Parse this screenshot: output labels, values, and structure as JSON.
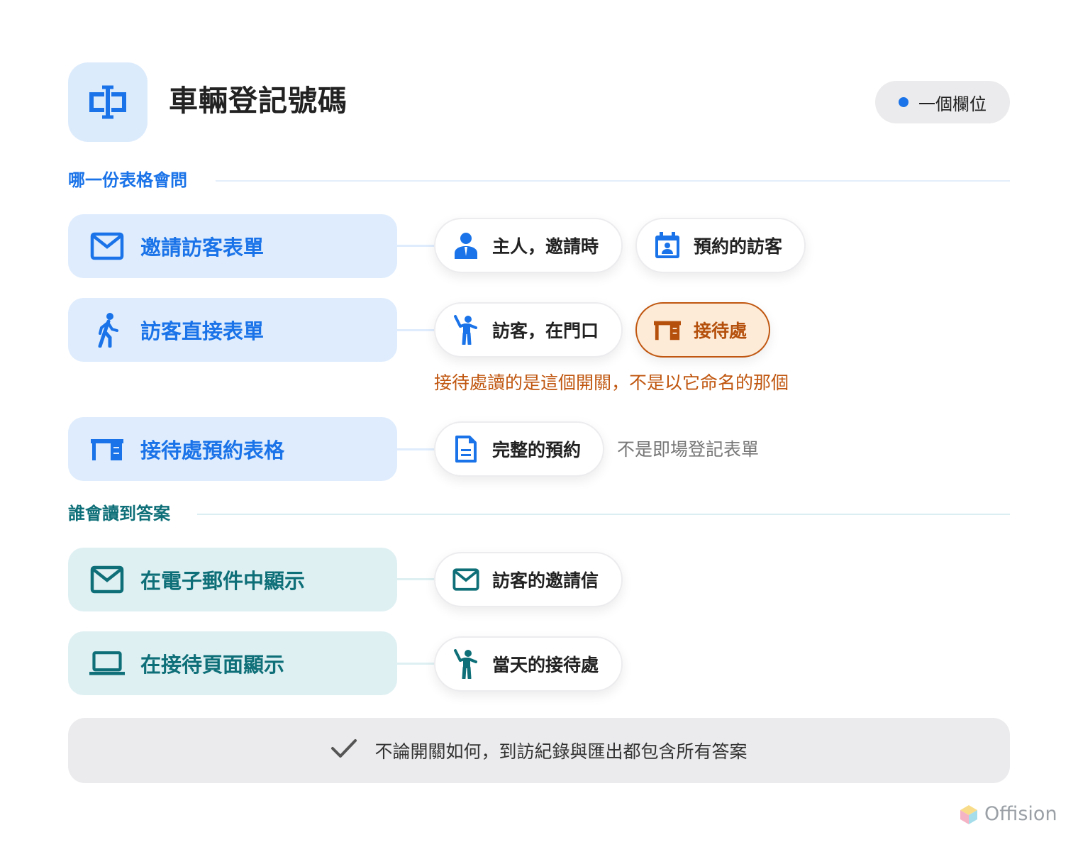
{
  "header": {
    "title": "車輛登記號碼",
    "badge": "一個欄位",
    "icon": "text-field-icon",
    "accent": "#1a73e8"
  },
  "sections": {
    "forms_heading": "哪一份表格會問",
    "readers_heading": "誰會讀到答案"
  },
  "forms": [
    {
      "label": "邀請訪客表單",
      "icon": "mail-icon",
      "chips": [
        {
          "label": "主人，邀請時",
          "icon": "host-person-icon"
        },
        {
          "label": "預約的訪客",
          "icon": "calendar-person-icon"
        }
      ]
    },
    {
      "label": "訪客直接表單",
      "icon": "walking-person-icon",
      "chips": [
        {
          "label": "訪客，在門口",
          "icon": "waving-person-icon"
        },
        {
          "label": "接待處",
          "icon": "reception-desk-icon",
          "highlight": true
        }
      ],
      "note": "接待處讀的是這個開關，不是以它命名的那個"
    },
    {
      "label": "接待處預約表格",
      "icon": "reception-desk-icon",
      "chips": [
        {
          "label": "完整的預約",
          "icon": "document-icon"
        }
      ],
      "note": "不是即場登記表單"
    }
  ],
  "readers": [
    {
      "label": "在電子郵件中顯示",
      "icon": "mail-icon",
      "chips": [
        {
          "label": "訪客的邀請信",
          "icon": "mail-icon"
        }
      ]
    },
    {
      "label": "在接待頁面顯示",
      "icon": "laptop-icon",
      "chips": [
        {
          "label": "當天的接待處",
          "icon": "waving-person-icon"
        }
      ]
    }
  ],
  "footer": {
    "text": "不論開關如何，到訪紀錄與匯出都包含所有答案",
    "icon": "check-icon"
  },
  "brand": {
    "name": "Offision"
  },
  "colors": {
    "blue": "#1a73e8",
    "teal": "#0e6f78",
    "orange": "#c0560f",
    "grey": "#777777"
  }
}
